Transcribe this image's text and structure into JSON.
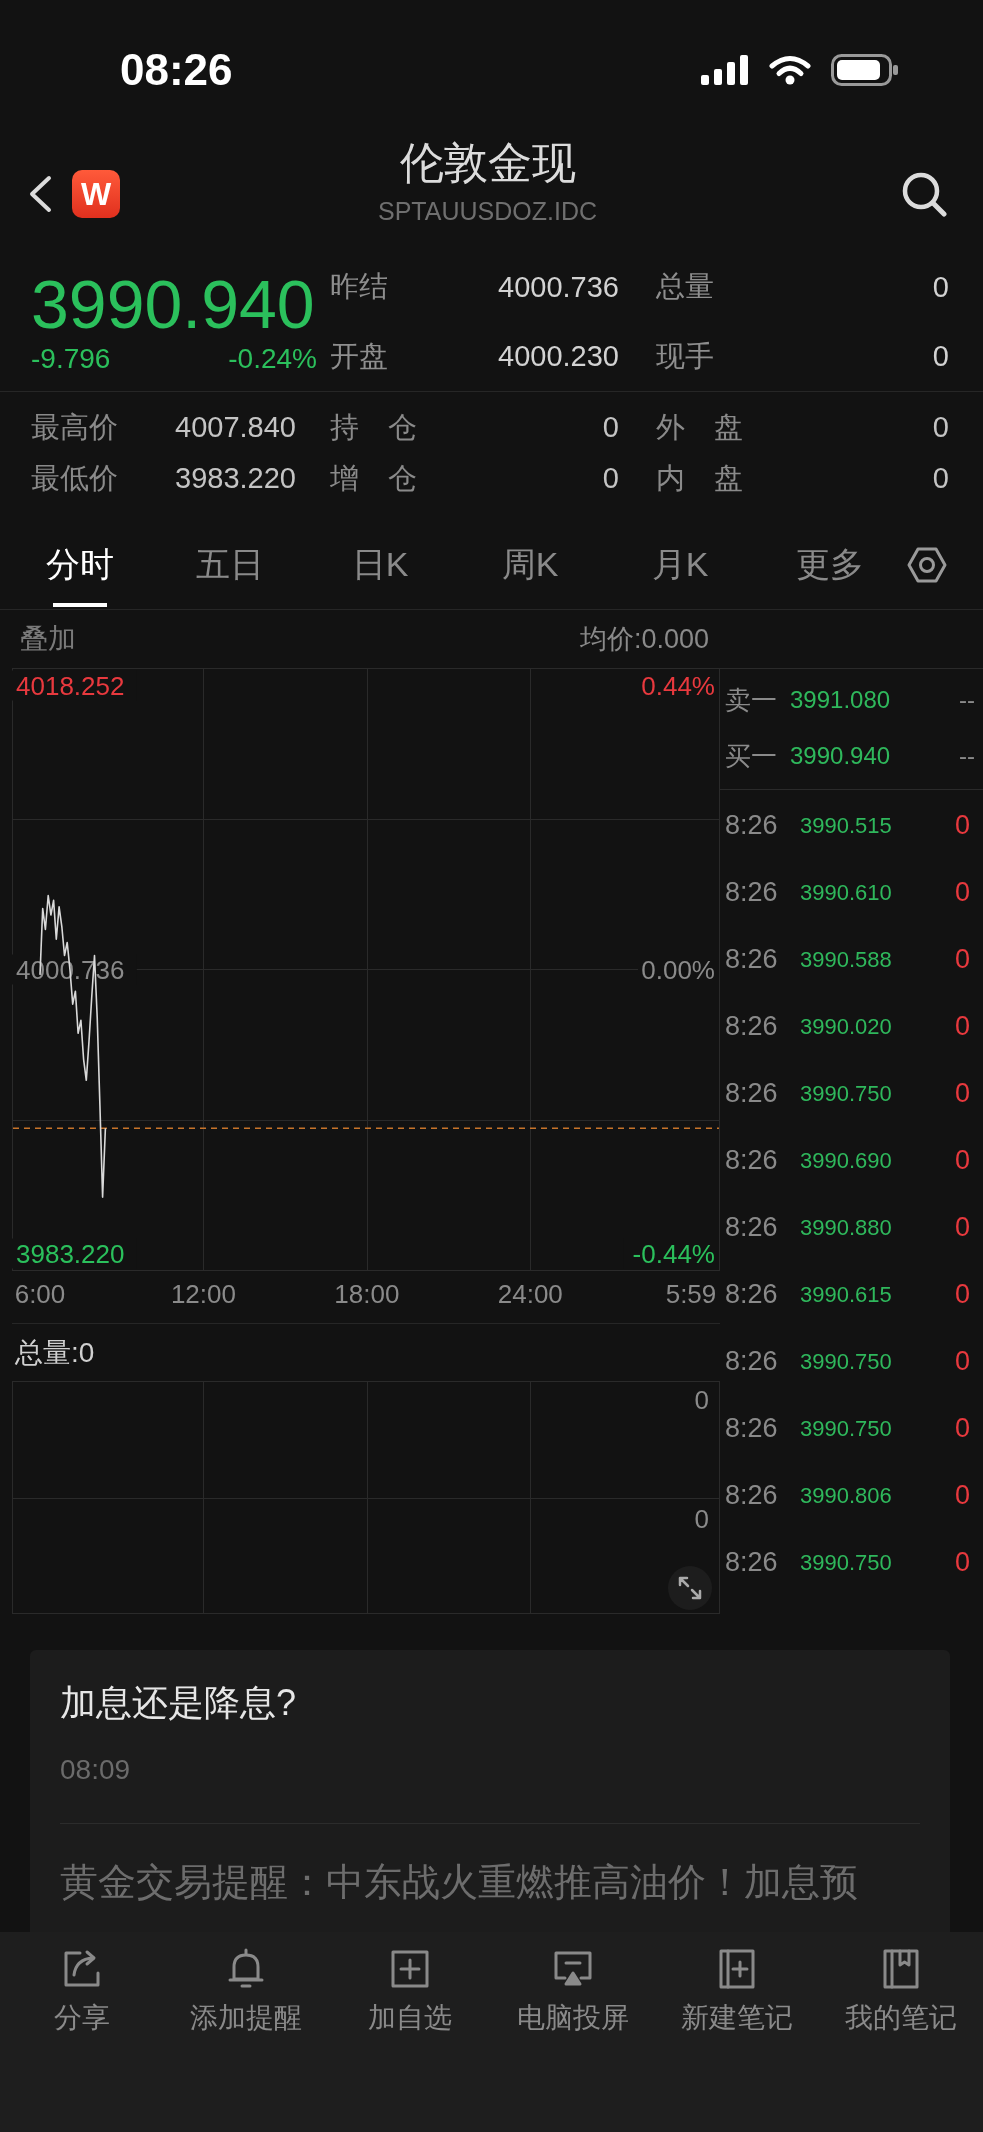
{
  "status_bar": {
    "time": "08:26"
  },
  "header": {
    "logo": "W",
    "title": "伦敦金现",
    "subtitle": "SPTAUUSDOZ.IDC"
  },
  "quote": {
    "price": "3990.940",
    "change": "-9.796",
    "change_percent": "-0.24%",
    "falling": true,
    "stats": [
      {
        "label": "昨结",
        "value": "4000.736"
      },
      {
        "label": "总量",
        "value": "0"
      },
      {
        "label": "开盘",
        "value": "4000.230"
      },
      {
        "label": "现手",
        "value": "0"
      }
    ]
  },
  "details": [
    {
      "label": "最高价",
      "value": "4007.840"
    },
    {
      "label": "持 仓",
      "value": "0"
    },
    {
      "label": "外 盘",
      "value": "0"
    },
    {
      "label": "最低价",
      "value": "3983.220"
    },
    {
      "label": "增 仓",
      "value": "0"
    },
    {
      "label": "内 盘",
      "value": "0"
    }
  ],
  "tabs": [
    {
      "label": "分时",
      "selected": true
    },
    {
      "label": "五日",
      "selected": false
    },
    {
      "label": "日K",
      "selected": false
    },
    {
      "label": "周K",
      "selected": false
    },
    {
      "label": "月K",
      "selected": false
    },
    {
      "label": "更多",
      "selected": false
    }
  ],
  "chart": {
    "overlay_label": "叠加",
    "average_label": "均价:0.000",
    "percent_labels": [
      "0.44%",
      "0.00%",
      "-0.44%"
    ],
    "chart_data": {
      "type": "line",
      "categories": [
        "6:00",
        null,
        null,
        null,
        null,
        null,
        null,
        null,
        null,
        null,
        null,
        null,
        null,
        null,
        null,
        null,
        null,
        null,
        null,
        null,
        null,
        null,
        null,
        null,
        null,
        null,
        null,
        null,
        null,
        null,
        null,
        null,
        null,
        null,
        null,
        null,
        null,
        null,
        null,
        null,
        null,
        null,
        null,
        null,
        null,
        null,
        null,
        null,
        null,
        null,
        null,
        null,
        null,
        null,
        null,
        null,
        null,
        null,
        null,
        null,
        "12:00",
        null,
        null,
        null,
        null,
        null,
        null,
        null,
        null,
        null,
        null,
        null,
        null,
        null,
        null,
        null,
        null,
        null,
        null,
        null,
        null,
        null,
        null,
        null,
        null,
        null,
        null,
        null,
        null,
        null,
        null,
        null,
        null,
        null,
        null,
        null,
        null,
        null,
        null,
        null,
        null,
        null,
        null,
        null,
        null,
        null,
        null,
        null,
        null,
        null,
        null,
        null,
        null,
        null,
        null,
        null,
        null,
        null,
        null,
        null,
        "18:00",
        null,
        null,
        null,
        null,
        null,
        null,
        null,
        null,
        null,
        null,
        null,
        null,
        null,
        null,
        null,
        null,
        null,
        null,
        null,
        null,
        null,
        null,
        null,
        null,
        null,
        null,
        null,
        null,
        null,
        null,
        null,
        null,
        null,
        null,
        null,
        null,
        null,
        null,
        null,
        null,
        null,
        null,
        null,
        null,
        null,
        null,
        null,
        null,
        null,
        null,
        null,
        null,
        null,
        null,
        null,
        null,
        null,
        null,
        null,
        "24:00",
        null,
        null,
        null,
        null,
        null,
        null,
        null,
        null,
        null,
        null,
        null,
        null,
        null,
        null,
        null,
        null,
        null,
        null,
        null,
        null,
        null,
        null,
        null,
        null,
        null,
        null,
        null,
        null,
        null,
        null,
        null,
        null,
        null,
        null,
        null,
        null,
        null,
        null,
        null,
        null,
        null,
        null,
        null,
        null,
        null,
        null,
        null,
        null,
        null,
        null,
        null,
        null,
        null,
        null,
        null,
        null,
        null,
        null,
        "5:59"
      ],
      "series": [
        {
          "color": "#d9d9d9",
          "values": [
            4000.4,
            4004.5,
            4003.2,
            4005.3,
            4004.1,
            4005.0,
            4002.6,
            4004.6,
            4003.4,
            4001.6,
            4002.4,
            4000.7,
            3998.6,
            3999.4,
            3996.8,
            3997.6,
            3995.2,
            3993.9,
            3996.3,
            3999.1,
            4001.6,
            3997.8,
            3992.4,
            3986.7,
            3990.94,
            null,
            null,
            null,
            null,
            null,
            null,
            null,
            null,
            null,
            null,
            null,
            null,
            null,
            null,
            null,
            null,
            null,
            null,
            null,
            null,
            null,
            null,
            null,
            null,
            null,
            null,
            null,
            null,
            null,
            null,
            null,
            null,
            null,
            null,
            null,
            null,
            null,
            null,
            null,
            null,
            null,
            null,
            null,
            null,
            null,
            null,
            null,
            null,
            null,
            null,
            null,
            null,
            null,
            null,
            null,
            null,
            null,
            null,
            null,
            null,
            null,
            null,
            null,
            null,
            null,
            null,
            null,
            null,
            null,
            null,
            null,
            null,
            null,
            null,
            null,
            null,
            null,
            null,
            null,
            null,
            null,
            null,
            null,
            null,
            null,
            null,
            null,
            null,
            null,
            null,
            null,
            null,
            null,
            null,
            null,
            null,
            null,
            null,
            null,
            null,
            null,
            null,
            null,
            null,
            null,
            null,
            null,
            null,
            null,
            null,
            null,
            null,
            null,
            null,
            null,
            null,
            null,
            null,
            null,
            null,
            null,
            null,
            null,
            null,
            null,
            null,
            null,
            null,
            null,
            null,
            null,
            null,
            null,
            null,
            null,
            null,
            null,
            null,
            null,
            null,
            null,
            null,
            null,
            null,
            null,
            null,
            null,
            null,
            null,
            null,
            null,
            null,
            null,
            null,
            null,
            null,
            null,
            null,
            null,
            null,
            null,
            null,
            null,
            null,
            null,
            null,
            null,
            null,
            null,
            null,
            null,
            null,
            null,
            null,
            null,
            null,
            null,
            null,
            null,
            null,
            null,
            null,
            null,
            null,
            null,
            null,
            null,
            null,
            null,
            null,
            null,
            null,
            null,
            null,
            null,
            null,
            null,
            null,
            null,
            null,
            null,
            null,
            null,
            null,
            null,
            null,
            null,
            null,
            null,
            null,
            null,
            null,
            null,
            null,
            null
          ]
        }
      ],
      "ylim": [
        3983.22,
        4018.252
      ],
      "yticks": [
        {
          "value": 3983.22,
          "label": "3983.220"
        },
        {
          "value": 4000.736,
          "label": "4000.736"
        },
        {
          "value": 4018.252,
          "label": "4018.252"
        }
      ],
      "ref_lines": [
        {
          "axis": "y",
          "value": 3990.94
        }
      ]
    }
  },
  "volume": {
    "label": "总量:0",
    "axis_labels": [
      "0",
      "0"
    ]
  },
  "order_book": {
    "quotes": [
      {
        "label": "卖一",
        "price": "3991.080",
        "volume": "--"
      },
      {
        "label": "买一",
        "price": "3990.940",
        "volume": "--"
      }
    ],
    "trades": [
      {
        "time": "8:26",
        "price": "3990.515",
        "volume": "0"
      },
      {
        "time": "8:26",
        "price": "3990.610",
        "volume": "0"
      },
      {
        "time": "8:26",
        "price": "3990.588",
        "volume": "0"
      },
      {
        "time": "8:26",
        "price": "3990.020",
        "volume": "0"
      },
      {
        "time": "8:26",
        "price": "3990.750",
        "volume": "0"
      },
      {
        "time": "8:26",
        "price": "3990.690",
        "volume": "0"
      },
      {
        "time": "8:26",
        "price": "3990.880",
        "volume": "0"
      },
      {
        "time": "8:26",
        "price": "3990.615",
        "volume": "0"
      },
      {
        "time": "8:26",
        "price": "3990.750",
        "volume": "0"
      },
      {
        "time": "8:26",
        "price": "3990.750",
        "volume": "0"
      },
      {
        "time": "8:26",
        "price": "3990.806",
        "volume": "0"
      },
      {
        "time": "8:26",
        "price": "3990.750",
        "volume": "0"
      }
    ]
  },
  "news": {
    "title": "加息还是降息?",
    "time": "08:09",
    "text": "黄金交易提醒：中东战火重燃推高油价！加息预"
  },
  "toolbar": [
    {
      "label": "分享"
    },
    {
      "label": "添加提醒"
    },
    {
      "label": "加自选"
    },
    {
      "label": "电脑投屏"
    },
    {
      "label": "新建笔记"
    },
    {
      "label": "我的笔记"
    }
  ]
}
